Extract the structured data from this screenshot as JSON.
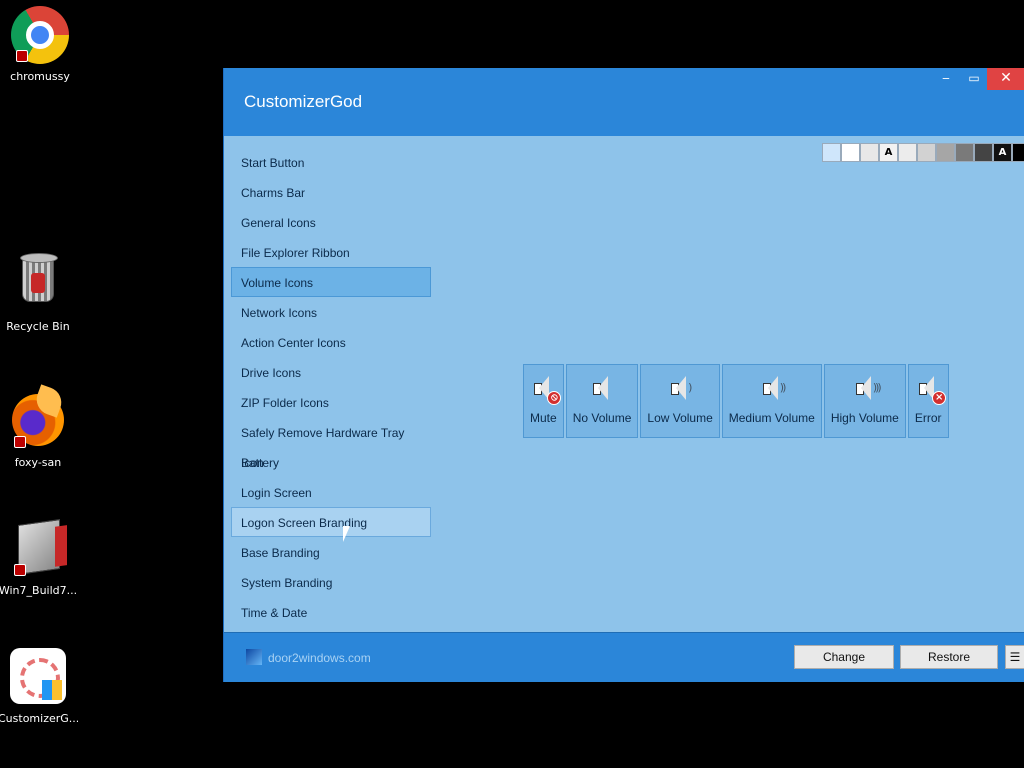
{
  "desktop": {
    "icons": [
      {
        "label": "chromussy",
        "icon": "chrome-icon"
      },
      {
        "label": "Recycle Bin",
        "icon": "recycle-bin-icon"
      },
      {
        "label": "foxy-san",
        "icon": "firefox-icon"
      },
      {
        "label": "Win7_Build7...",
        "icon": "win7-build-icon"
      },
      {
        "label": "CustomizerG...",
        "icon": "customizergod-icon"
      }
    ]
  },
  "window": {
    "title": "CustomizerGod",
    "controls": {
      "minimize": "‒",
      "maximize": "▭",
      "close": "✕"
    }
  },
  "sidebar": {
    "items": [
      {
        "label": "Start Button"
      },
      {
        "label": "Charms Bar"
      },
      {
        "label": "General Icons"
      },
      {
        "label": "File Explorer Ribbon"
      },
      {
        "label": "Volume Icons",
        "selected": true
      },
      {
        "label": "Network Icons"
      },
      {
        "label": "Action Center Icons"
      },
      {
        "label": "Drive Icons"
      },
      {
        "label": "ZIP Folder Icons"
      },
      {
        "label": "Safely Remove Hardware Tray Icon"
      },
      {
        "label": "Battery"
      },
      {
        "label": "Login Screen"
      },
      {
        "label": "Logon Screen Branding",
        "hover": true
      },
      {
        "label": "Base Branding"
      },
      {
        "label": "System Branding"
      },
      {
        "label": "Time & Date"
      }
    ]
  },
  "swatches": [
    {
      "color": "#cfe6fb",
      "text": ""
    },
    {
      "color": "#ffffff",
      "text": ""
    },
    {
      "color": "#e8e8e8",
      "text": ""
    },
    {
      "color": "#f2f2f2",
      "text": "A"
    },
    {
      "color": "#ececec",
      "text": ""
    },
    {
      "color": "#d2d2d2",
      "text": ""
    },
    {
      "color": "#a6a6a6",
      "text": ""
    },
    {
      "color": "#7a7a7a",
      "text": ""
    },
    {
      "color": "#444444",
      "text": ""
    },
    {
      "color": "#111111",
      "text": "A"
    },
    {
      "color": "#000000",
      "text": ""
    }
  ],
  "volume_icons": [
    {
      "label": "Mute",
      "badge": "no"
    },
    {
      "label": "No Volume",
      "waves": ""
    },
    {
      "label": "Low Volume",
      "waves": ")"
    },
    {
      "label": "Medium Volume",
      "waves": "))"
    },
    {
      "label": "High Volume",
      "waves": ")))"
    },
    {
      "label": "Error",
      "badge": "x"
    }
  ],
  "footer": {
    "brand": "door2windows.com",
    "change_label": "Change",
    "restore_label": "Restore",
    "menu_label": "☰"
  }
}
